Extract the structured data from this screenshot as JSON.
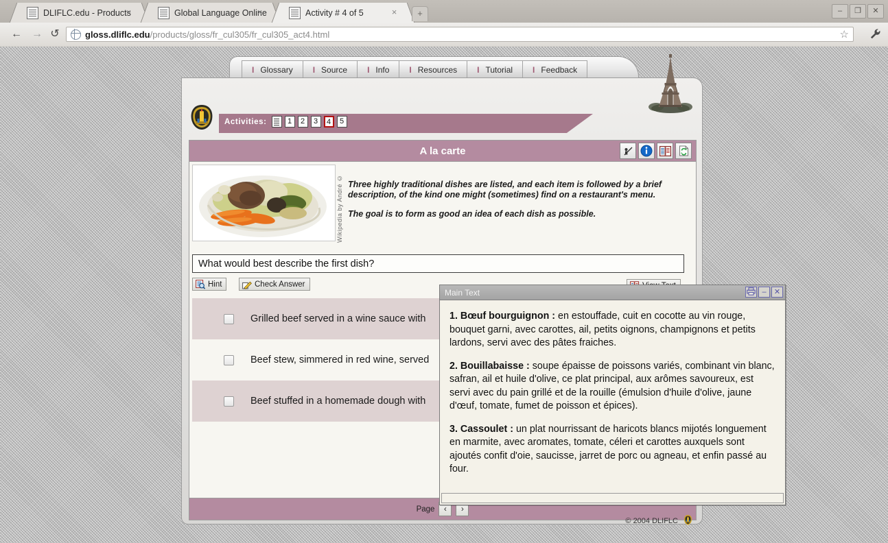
{
  "browser": {
    "tabs": [
      {
        "title": "DLIFLC.edu - Products",
        "active": false,
        "close_label": "×"
      },
      {
        "title": "Global Language Online",
        "active": false,
        "close_label": "×"
      },
      {
        "title": "Activity # 4 of 5",
        "active": true,
        "close_label": "×"
      }
    ],
    "new_tab_label": "+",
    "window_buttons": [
      {
        "name": "minimize",
        "glyph": "–"
      },
      {
        "name": "maximize",
        "glyph": "❐"
      },
      {
        "name": "close",
        "glyph": "✕"
      }
    ],
    "nav": {
      "back": "←",
      "forward": "→",
      "reload": "↺"
    },
    "url": {
      "domain": "gloss.dliflc.edu",
      "path": "/products/gloss/fr_cul305/fr_cul305_act4.html",
      "full": "gloss.dliflc.edu/products/gloss/fr_cul305/fr_cul305_act4.html"
    },
    "star_glyph": "☆",
    "wrench_glyph": "🔧"
  },
  "app": {
    "tabs": [
      {
        "label": "Glossary"
      },
      {
        "label": "Source"
      },
      {
        "label": "Info"
      },
      {
        "label": "Resources"
      },
      {
        "label": "Tutorial"
      },
      {
        "label": "Feedback"
      }
    ],
    "tab_bullet": "I",
    "activities": {
      "label": "Activities:",
      "items": [
        "1",
        "2",
        "3",
        "4",
        "5"
      ],
      "current": "4"
    },
    "card": {
      "title": "A la carte",
      "tools": [
        {
          "name": "pointer-teacher-icon",
          "glyph": "🎯"
        },
        {
          "name": "info-icon",
          "glyph": "i"
        },
        {
          "name": "book-icon",
          "glyph": "📕"
        },
        {
          "name": "refresh-page-icon",
          "glyph": "↻"
        }
      ],
      "image_credit": "Wikipedia by André ©",
      "intro_paragraphs": [
        "Three highly traditional dishes are listed, and each item is followed by a brief description, of the kind one might (sometimes) find on a restaurant's menu.",
        "The goal is to form as good an idea of each dish as possible."
      ],
      "question": "What would best describe the first dish?",
      "buttons": {
        "hint": "Hint",
        "check_answer": "Check Answer",
        "view_text": "View Text"
      },
      "options": [
        {
          "text": "Grilled beef served in a wine sauce with"
        },
        {
          "text": "Beef stew, simmered in red wine, served"
        },
        {
          "text": "Beef stuffed in a homemade dough with"
        }
      ],
      "footer": {
        "page_label": "Page",
        "prev_glyph": "‹",
        "next_glyph": "›"
      }
    },
    "copyright": "© 2004 DLIFLC"
  },
  "main_text_window": {
    "title": "Main Text",
    "buttons": [
      {
        "name": "print",
        "glyph": "⎙"
      },
      {
        "name": "minimize",
        "glyph": "–"
      },
      {
        "name": "close",
        "glyph": "✕"
      }
    ],
    "entries": [
      {
        "heading": "1. Bœuf bourguignon :",
        "body": " en estouffade, cuit  en cocotte au vin rouge, bouquet garni, avec carottes, ail, petits oignons, champignons et petits lardons, servi avec des pâtes fraiches."
      },
      {
        "heading": "2. Bouillabaisse :",
        "body": " soupe épaisse de poissons variés, combinant vin blanc, safran, ail et huile d'olive, ce plat principal, aux arômes savoureux, est servi avec du pain grillé et de la rouille (émulsion d'huile d'olive, jaune d'œuf, tomate, fumet de poisson et épices)."
      },
      {
        "heading": "3. Cassoulet :",
        "body": " un plat nourrissant de haricots blancs mijotés longuement en marmite, avec aromates, tomate, céleri et carottes auxquels sont ajoutés confit d'oie, saucisse,  jarret de porc ou agneau, et enfin passé au four."
      }
    ]
  },
  "colors": {
    "accent_mauve": "#b48ba0",
    "accent_dark_mauve": "#a6798c",
    "option_shade": "#ded2d2",
    "card_bg": "#f7f6f1",
    "maintext_bg": "#f4f2e9"
  }
}
